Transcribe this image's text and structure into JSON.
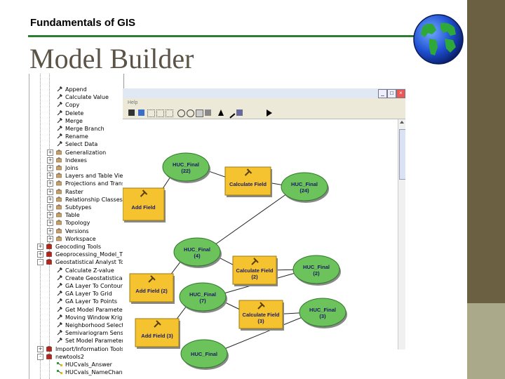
{
  "slide": {
    "course": "Fundamentals of GIS",
    "title": "Model Builder"
  },
  "toolbox": {
    "items": [
      {
        "label": "Append",
        "icon": "hammer-icon",
        "expander": ""
      },
      {
        "label": "Calculate Value",
        "icon": "hammer-icon",
        "expander": ""
      },
      {
        "label": "Copy",
        "icon": "hammer-icon",
        "expander": ""
      },
      {
        "label": "Delete",
        "icon": "hammer-icon",
        "expander": ""
      },
      {
        "label": "Merge",
        "icon": "hammer-icon",
        "expander": ""
      },
      {
        "label": "Merge Branch",
        "icon": "hammer-icon",
        "expander": ""
      },
      {
        "label": "Rename",
        "icon": "hammer-icon",
        "expander": ""
      },
      {
        "label": "Select Data",
        "icon": "hammer-icon",
        "expander": ""
      },
      {
        "label": "Generalization",
        "icon": "toolset-icon",
        "expander": "+"
      },
      {
        "label": "Indexes",
        "icon": "toolset-icon",
        "expander": "+"
      },
      {
        "label": "Joins",
        "icon": "toolset-icon",
        "expander": "+"
      },
      {
        "label": "Layers and Table View",
        "icon": "toolset-icon",
        "expander": "+"
      },
      {
        "label": "Projections and Trans",
        "icon": "toolset-icon",
        "expander": "+"
      },
      {
        "label": "Raster",
        "icon": "toolset-icon",
        "expander": "+"
      },
      {
        "label": "Relationship Classes",
        "icon": "toolset-icon",
        "expander": "+"
      },
      {
        "label": "Subtypes",
        "icon": "toolset-icon",
        "expander": "+"
      },
      {
        "label": "Table",
        "icon": "toolset-icon",
        "expander": "+"
      },
      {
        "label": "Topology",
        "icon": "toolset-icon",
        "expander": "+"
      },
      {
        "label": "Versions",
        "icon": "toolset-icon",
        "expander": "+"
      },
      {
        "label": "Workspace",
        "icon": "toolset-icon",
        "expander": "+"
      },
      {
        "label": "Geocoding Tools",
        "icon": "toolbox-icon",
        "expander": "+"
      },
      {
        "label": "Geoprocessing_Model_T",
        "icon": "toolbox-icon",
        "expander": "+"
      },
      {
        "label": "Geostatistical Analyst Too",
        "icon": "toolbox-icon",
        "expander": "-"
      },
      {
        "label": "Calculate Z-value",
        "icon": "hammer-icon",
        "expander": ""
      },
      {
        "label": "Create Geostatistical",
        "icon": "hammer-icon",
        "expander": ""
      },
      {
        "label": "GA Layer To Contour",
        "icon": "hammer-icon",
        "expander": ""
      },
      {
        "label": "GA Layer To Grid",
        "icon": "hammer-icon",
        "expander": ""
      },
      {
        "label": "GA Layer To Points",
        "icon": "hammer-icon",
        "expander": ""
      },
      {
        "label": "Get Model Parameter",
        "icon": "hammer-icon",
        "expander": ""
      },
      {
        "label": "Moving Window Kriging",
        "icon": "hammer-icon",
        "expander": ""
      },
      {
        "label": "Neighborhood Selection",
        "icon": "hammer-icon",
        "expander": ""
      },
      {
        "label": "Semivariogram Sens",
        "icon": "hammer-icon",
        "expander": ""
      },
      {
        "label": "Set Model Parameter",
        "icon": "hammer-icon",
        "expander": ""
      },
      {
        "label": "Import/Information Tools",
        "icon": "toolbox-icon",
        "expander": "+"
      },
      {
        "label": "newtools2",
        "icon": "toolbox-icon",
        "expander": "-"
      },
      {
        "label": "HUCvals_Answer",
        "icon": "model-icon",
        "expander": ""
      },
      {
        "label": "HUCvals_NameChange",
        "icon": "model-icon",
        "expander": ""
      }
    ]
  },
  "window": {
    "menu_help": "Help",
    "minimize": "_",
    "maximize": "□",
    "close": "×"
  },
  "model": {
    "nodes": [
      {
        "id": "huc22",
        "shape": "ellipse",
        "label1": "HUC_Final",
        "label2": "(22)"
      },
      {
        "id": "calc1",
        "shape": "rect",
        "label1": "Calculate Field",
        "label2": ""
      },
      {
        "id": "huc24",
        "shape": "ellipse",
        "label1": "HUC_Final",
        "label2": "(24)"
      },
      {
        "id": "add1",
        "shape": "rect",
        "label1": "Add Field",
        "label2": ""
      },
      {
        "id": "huc4",
        "shape": "ellipse",
        "label1": "HUC_Final",
        "label2": "(4)"
      },
      {
        "id": "calc2",
        "shape": "rect",
        "label1": "Calculate Field",
        "label2": "(2)"
      },
      {
        "id": "huc2",
        "shape": "ellipse",
        "label1": "HUC_Final",
        "label2": "(2)"
      },
      {
        "id": "add2",
        "shape": "rect",
        "label1": "Add Field (2)",
        "label2": ""
      },
      {
        "id": "huc7",
        "shape": "ellipse",
        "label1": "HUC_Final",
        "label2": "(7)"
      },
      {
        "id": "calc3",
        "shape": "rect",
        "label1": "Calculate Field",
        "label2": "(3)"
      },
      {
        "id": "huc3",
        "shape": "ellipse",
        "label1": "HUC_Final",
        "label2": "(3)"
      },
      {
        "id": "add3",
        "shape": "rect",
        "label1": "Add Field (3)",
        "label2": ""
      },
      {
        "id": "huc_bottom",
        "shape": "ellipse",
        "label1": "HUC_Final",
        "label2": ""
      }
    ],
    "colors": {
      "process": "#f5c330",
      "data": "#6cc35c"
    }
  }
}
